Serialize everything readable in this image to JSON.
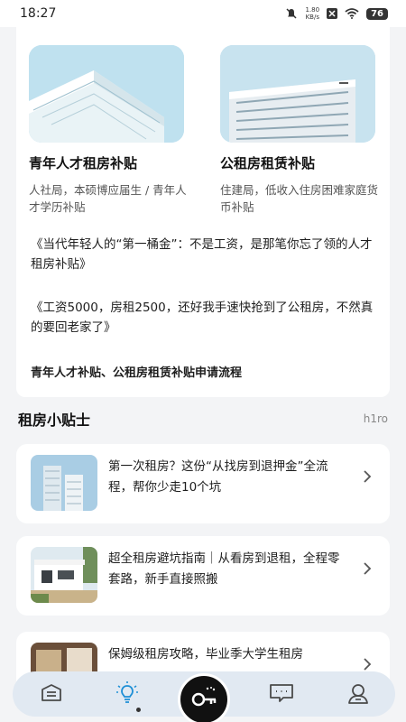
{
  "status_bar": {
    "time": "18:27",
    "speed_value": "1.80",
    "speed_unit": "KB/s",
    "battery": "76"
  },
  "subsidies": [
    {
      "title": "青年人才租房补贴",
      "desc": "人社局，本硕博应届生 / 青年人才学历补贴"
    },
    {
      "title": "公租房租赁补贴",
      "desc": "住建局，低收入住房困难家庭货币补贴"
    }
  ],
  "articles": [
    "《当代年轻人的“第一桶金”：不是工资，是那笔你忘了领的人才租房补贴》",
    "《工资5000，房租2500，还好我手速快抢到了公租房，不然真的要回老家了》",
    "青年人才补贴、公租房租赁补贴申请流程"
  ],
  "tips_section": {
    "title": "租房小贴士",
    "more": "h1ro"
  },
  "tips": [
    {
      "text": "第一次租房？这份“从找房到退押金”全流程，帮你少走10个坑"
    },
    {
      "text": "超全租房避坑指南｜从看房到退租，全程零套路，新手直接照搬"
    },
    {
      "text": "保姆级租房攻略，毕业季大学生租房"
    }
  ],
  "tab_bar": {
    "icons": [
      "list-icon",
      "lightbulb-icon",
      "key-icon",
      "message-icon",
      "profile-icon"
    ],
    "active_index": 1
  },
  "colors": {
    "background": "#f3f4f6",
    "card": "#ffffff",
    "tab_bar": "#e1e9f2",
    "fab": "#111111"
  }
}
